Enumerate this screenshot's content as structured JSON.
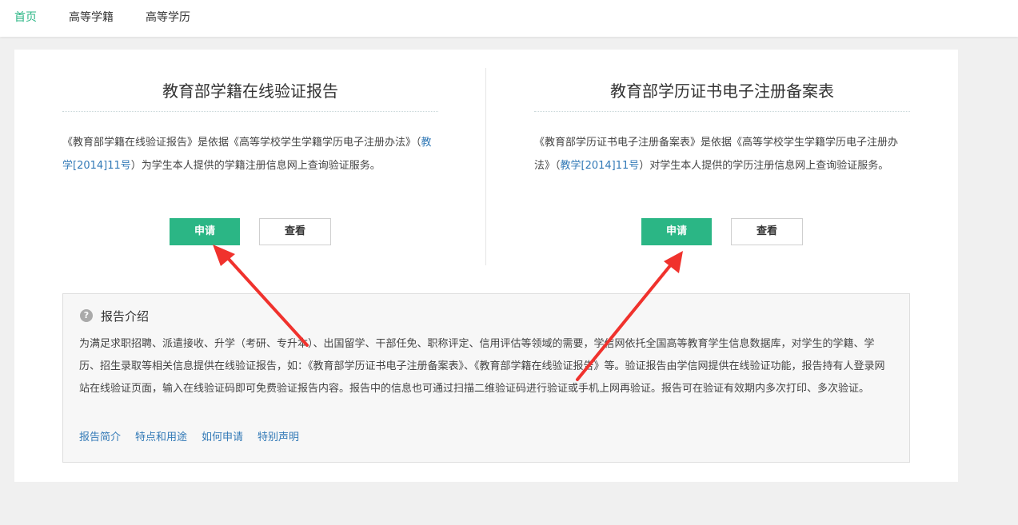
{
  "nav": {
    "items": [
      "首页",
      "高等学籍",
      "高等学历"
    ],
    "active_index": 0
  },
  "panels": [
    {
      "title": "教育部学籍在线验证报告",
      "desc_before": "《教育部学籍在线验证报告》是依据《高等学校学生学籍学历电子注册办法》（",
      "desc_link": "教学[2014]11号",
      "desc_after": "）为学生本人提供的学籍注册信息网上查询验证服务。",
      "apply_label": "申请",
      "view_label": "查看"
    },
    {
      "title": "教育部学历证书电子注册备案表",
      "desc_before": "《教育部学历证书电子注册备案表》是依据《高等学校学生学籍学历电子注册办法》（",
      "desc_link": "教学[2014]11号",
      "desc_after": "）对学生本人提供的学历注册信息网上查询验证服务。",
      "apply_label": "申请",
      "view_label": "查看"
    }
  ],
  "intro": {
    "icon": "?",
    "title": "报告介绍",
    "body": "为满足求职招聘、派遣接收、升学（考研、专升本）、出国留学、干部任免、职称评定、信用评估等领域的需要，学信网依托全国高等教育学生信息数据库，对学生的学籍、学历、招生录取等相关信息提供在线验证报告，如：《教育部学历证书电子注册备案表》、《教育部学籍在线验证报告》等。验证报告由学信网提供在线验证功能，报告持有人登录网站在线验证页面，输入在线验证码即可免费验证报告内容。报告中的信息也可通过扫描二维验证码进行验证或手机上网再验证。报告可在验证有效期内多次打印、多次验证。",
    "links": [
      "报告简介",
      "特点和用途",
      "如何申请",
      "特别声明"
    ]
  },
  "colors": {
    "accent": "#2bb685",
    "link": "#337ab7",
    "arrow": "#f0322d"
  }
}
